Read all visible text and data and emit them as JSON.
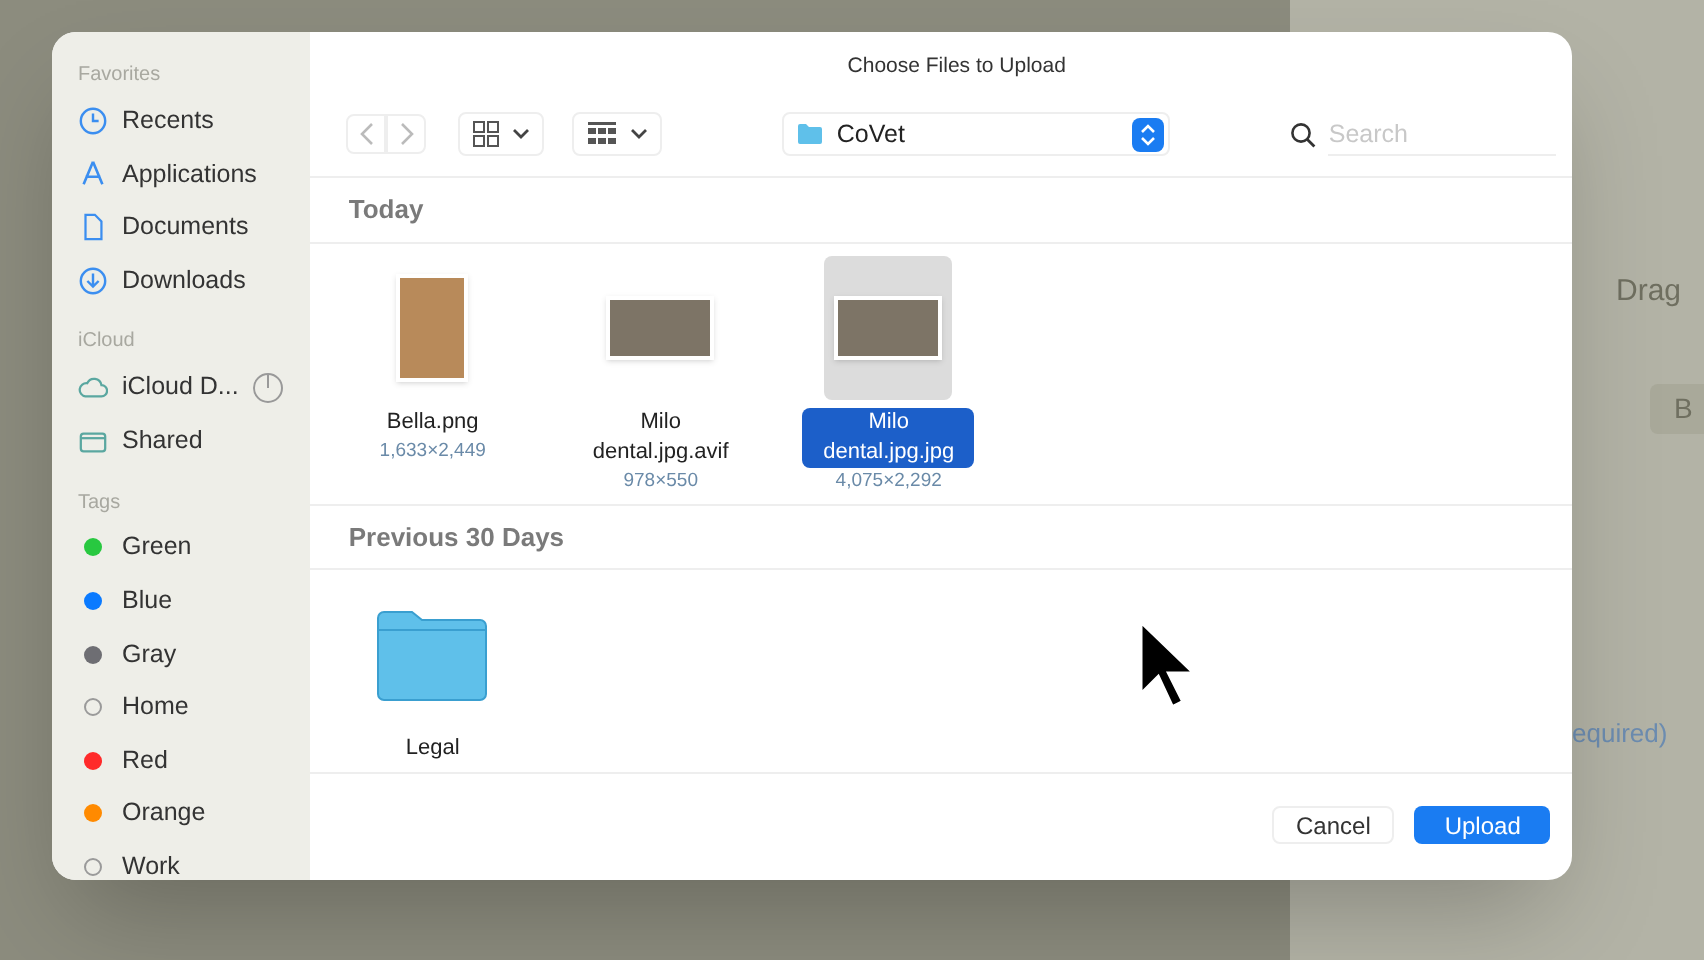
{
  "background": {
    "texts": [
      {
        "text": "Drag",
        "kind": "plain"
      },
      {
        "text": "B",
        "kind": "chip"
      },
      {
        "text": "equired)",
        "kind": "link"
      }
    ]
  },
  "dialog": {
    "title": "Choose Files to Upload",
    "sidebar": [
      {
        "heading": "Favorites",
        "items": [
          {
            "label": "Recents",
            "kind": "clock"
          },
          {
            "label": "Applications",
            "kind": "apps"
          },
          {
            "label": "Documents",
            "kind": "doc"
          },
          {
            "label": "Downloads",
            "kind": "download"
          }
        ]
      },
      {
        "heading": "iCloud",
        "items": [
          {
            "label": "iCloud D...",
            "kind": "cloud"
          },
          {
            "label": "Shared",
            "kind": "shared"
          }
        ]
      },
      {
        "heading": "Tags",
        "items": [
          {
            "label": "Green",
            "kind": "tag",
            "color": "#28c840"
          },
          {
            "label": "Blue",
            "kind": "tag",
            "color": "#0a7aff"
          },
          {
            "label": "Gray",
            "kind": "tag",
            "color": "#6e6e73"
          },
          {
            "label": "Home",
            "kind": "tag-empty"
          },
          {
            "label": "Red",
            "kind": "tag",
            "color": "#ff2a2a"
          },
          {
            "label": "Orange",
            "kind": "tag",
            "color": "#ff8a00"
          },
          {
            "label": "Work",
            "kind": "tag-empty"
          }
        ]
      }
    ],
    "location": "CoVet",
    "search": {
      "placeholder": "Search"
    },
    "groups": [
      {
        "heading": "Today",
        "files": [
          {
            "name": "Bella.png",
            "dims": "1,633×2,449",
            "kind": "portrait",
            "selected": false
          },
          {
            "name": "Milo dental.jpg.avif",
            "dims": "978×550",
            "kind": "landscape",
            "selected": false
          },
          {
            "name": "Milo dental.jpg.jpg",
            "dims": "4,075×2,292",
            "kind": "landscape",
            "selected": true
          }
        ]
      },
      {
        "heading": "Previous 30 Days",
        "files": [
          {
            "name": "Legal",
            "kind": "folder",
            "selected": false
          }
        ]
      }
    ],
    "buttons": [
      {
        "label": "Cancel",
        "kind": "secondary"
      },
      {
        "label": "Upload",
        "kind": "primary"
      }
    ]
  }
}
